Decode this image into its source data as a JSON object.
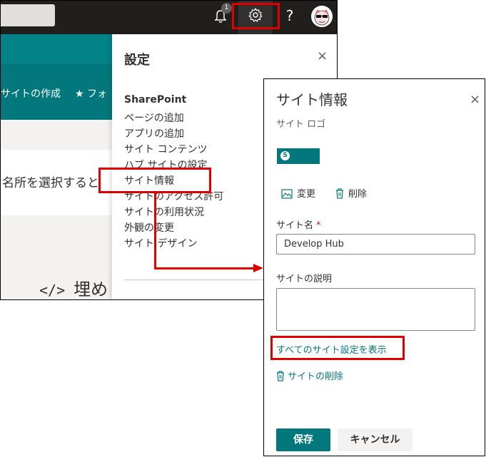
{
  "topbar": {
    "notification_count": "1",
    "help_label": "?"
  },
  "background_page": {
    "create_site": "サイトの作成",
    "follow": "★ フォ",
    "content_text": "名所を選択すると",
    "embed_code_icon": "</>",
    "embed_text": "埋め"
  },
  "settings_panel": {
    "title": "設定",
    "close_label": "×",
    "section_heading": "SharePoint",
    "items": [
      "ページの追加",
      "アプリの追加",
      "サイト コンテンツ",
      "ハブ サイトの設定",
      "サイト情報",
      "サイトのアクセス許可",
      "サイトの利用状況",
      "外観の変更",
      "サイト デザイン"
    ]
  },
  "site_info_panel": {
    "title": "サイト情報",
    "close_label": "×",
    "logo_label": "サイト ロゴ",
    "logo_letter": "S",
    "change_label": "変更",
    "delete_label": "削除",
    "site_name_label": "サイト名",
    "required_mark": "*",
    "site_name_value": "Develop Hub",
    "description_label": "サイトの説明",
    "description_value": "",
    "all_settings_link": "すべてのサイト設定を表示",
    "delete_site_link": "サイトの削除",
    "save_label": "保存",
    "cancel_label": "キャンセル"
  },
  "colors": {
    "accent": "#03787c",
    "annotation_red": "#e00000",
    "topbar": "#201f1e"
  }
}
